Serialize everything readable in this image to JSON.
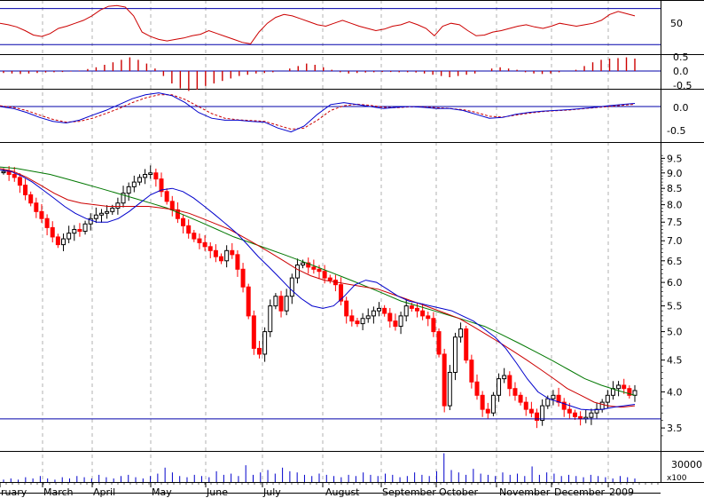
{
  "chart_data": {
    "type": "candlestick",
    "months": [
      "ruary",
      "March",
      "April",
      "May",
      "June",
      "July",
      "August",
      "September",
      "October",
      "November",
      "December",
      "2009"
    ],
    "price_axis": {
      "ticks": [
        "3.5",
        "4.0",
        "4.5",
        "5.0",
        "5.5",
        "6.0",
        "6.5",
        "7.0",
        "7.5",
        "8.0",
        "8.5",
        "9.0",
        "9.5"
      ],
      "ylim": [
        3.3,
        9.7
      ],
      "scale": "log",
      "horizontal_line": 3.62
    },
    "rsi_panel": {
      "ticks": [
        "50"
      ],
      "lines": [
        82,
        33
      ]
    },
    "histogram_panel": {
      "ticks": [
        "0.5",
        "0.0",
        "-0.5"
      ]
    },
    "macd_panel": {
      "ticks": [
        "0.0",
        "-0.5"
      ]
    },
    "volume_panel": {
      "ticks": [
        "30000",
        "x100"
      ]
    },
    "colors": {
      "up_candle": "#000000",
      "down_candle": "#ff0000",
      "ma_short": "#0000cc",
      "ma_medium": "#cc0000",
      "ma_long": "#007700",
      "panel_line": "#0000aa",
      "indicator": "#cc0000"
    },
    "price_series": [
      9.05,
      8.95,
      8.85,
      8.6,
      8.3,
      8.05,
      7.8,
      7.6,
      7.35,
      7.1,
      6.9,
      7.05,
      7.2,
      7.3,
      7.25,
      7.45,
      7.6,
      7.7,
      7.75,
      7.8,
      7.9,
      8.05,
      8.35,
      8.55,
      8.7,
      8.85,
      8.95,
      9.0,
      8.8,
      8.4,
      8.1,
      7.85,
      7.6,
      7.4,
      7.2,
      7.05,
      6.95,
      6.85,
      6.75,
      6.6,
      6.5,
      6.75,
      6.65,
      6.3,
      5.9,
      5.3,
      4.7,
      4.6,
      5.0,
      5.5,
      5.7,
      5.4,
      5.7,
      6.1,
      6.4,
      6.45,
      6.35,
      6.3,
      6.25,
      6.1,
      6.05,
      5.95,
      5.6,
      5.3,
      5.2,
      5.15,
      5.25,
      5.3,
      5.4,
      5.45,
      5.35,
      5.2,
      5.1,
      5.3,
      5.5,
      5.45,
      5.4,
      5.3,
      5.25,
      5.0,
      4.6,
      3.8,
      4.3,
      4.9,
      5.05,
      4.5,
      4.15,
      3.95,
      3.75,
      3.7,
      3.95,
      4.2,
      4.25,
      4.05,
      3.95,
      3.85,
      3.75,
      3.7,
      3.6,
      3.8,
      3.9,
      3.95,
      3.85,
      3.75,
      3.7,
      3.65,
      3.62,
      3.64,
      3.7,
      3.75,
      3.85,
      3.95,
      4.05,
      4.1,
      4.05,
      3.95,
      4.02
    ],
    "ma_short": [
      9.1,
      9.05,
      8.9,
      8.7,
      8.45,
      8.2,
      7.95,
      7.75,
      7.6,
      7.5,
      7.5,
      7.6,
      7.8,
      8.05,
      8.3,
      8.45,
      8.5,
      8.4,
      8.2,
      7.95,
      7.7,
      7.45,
      7.2,
      6.9,
      6.6,
      6.35,
      6.1,
      5.85,
      5.65,
      5.5,
      5.45,
      5.5,
      5.7,
      5.95,
      6.05,
      6.0,
      5.85,
      5.7,
      5.6,
      5.55,
      5.5,
      5.45,
      5.4,
      5.3,
      5.2,
      5.05,
      4.9,
      4.7,
      4.45,
      4.2,
      4.0,
      3.9,
      3.85,
      3.8,
      3.75,
      3.74,
      3.75,
      3.78,
      3.8,
      3.82
    ],
    "ma_medium": [
      9.15,
      9.05,
      8.85,
      8.6,
      8.35,
      8.15,
      8.05,
      8.0,
      7.95,
      7.95,
      7.95,
      7.95,
      7.9,
      7.85,
      7.75,
      7.6,
      7.45,
      7.3,
      7.1,
      6.9,
      6.7,
      6.5,
      6.3,
      6.15,
      6.05,
      6.0,
      5.95,
      5.9,
      5.85,
      5.75,
      5.65,
      5.55,
      5.45,
      5.35,
      5.25,
      5.1,
      4.95,
      4.8,
      4.65,
      4.5,
      4.35,
      4.2,
      4.05,
      3.95,
      3.85,
      3.8,
      3.78,
      3.8
    ],
    "ma_long": [
      9.2,
      9.15,
      9.05,
      8.95,
      8.8,
      8.65,
      8.5,
      8.35,
      8.2,
      8.05,
      7.9,
      7.7,
      7.5,
      7.3,
      7.1,
      6.95,
      6.8,
      6.65,
      6.5,
      6.35,
      6.2,
      6.05,
      5.9,
      5.75,
      5.6,
      5.5,
      5.4,
      5.3,
      5.2,
      5.1,
      4.95,
      4.8,
      4.65,
      4.5,
      4.35,
      4.2,
      4.1,
      4.02,
      3.95
    ],
    "rsi_series": [
      62,
      60,
      57,
      52,
      46,
      44,
      48,
      55,
      58,
      62,
      66,
      72,
      80,
      85,
      86,
      84,
      72,
      50,
      44,
      40,
      38,
      40,
      42,
      45,
      47,
      52,
      48,
      44,
      40,
      36,
      34,
      50,
      62,
      70,
      74,
      72,
      68,
      64,
      60,
      58,
      62,
      66,
      62,
      58,
      55,
      52,
      54,
      58,
      60,
      64,
      60,
      55,
      45,
      58,
      62,
      60,
      52,
      45,
      46,
      50,
      52,
      55,
      58,
      60,
      57,
      55,
      58,
      62,
      60,
      58,
      60,
      62,
      66,
      74,
      78,
      75,
      72
    ],
    "histogram_series": [
      -0.08,
      -0.1,
      -0.12,
      -0.1,
      -0.08,
      -0.06,
      -0.05,
      -0.04,
      -0.02,
      0.02,
      0.08,
      0.15,
      0.25,
      0.35,
      0.45,
      0.55,
      0.45,
      0.3,
      0.1,
      -0.2,
      -0.5,
      -0.7,
      -0.8,
      -0.75,
      -0.6,
      -0.5,
      -0.4,
      -0.3,
      -0.2,
      -0.15,
      -0.1,
      -0.08,
      -0.05,
      0.0,
      0.1,
      0.2,
      0.3,
      0.25,
      0.15,
      0.05,
      -0.05,
      -0.1,
      -0.08,
      -0.06,
      -0.05,
      -0.04,
      -0.04,
      -0.05,
      -0.05,
      -0.06,
      -0.1,
      -0.15,
      -0.2,
      -0.25,
      -0.2,
      -0.15,
      -0.1,
      0.0,
      0.1,
      0.15,
      0.1,
      0.05,
      -0.05,
      -0.1,
      -0.12,
      -0.1,
      -0.05,
      0.0,
      0.05,
      0.2,
      0.35,
      0.45,
      0.5,
      0.52,
      0.55,
      0.5
    ],
    "macd_series": [
      0.0,
      -0.05,
      -0.15,
      -0.28,
      -0.38,
      -0.42,
      -0.35,
      -0.22,
      -0.1,
      0.05,
      0.2,
      0.3,
      0.35,
      0.28,
      0.1,
      -0.15,
      -0.3,
      -0.35,
      -0.35,
      -0.38,
      -0.4,
      -0.55,
      -0.65,
      -0.5,
      -0.2,
      0.05,
      0.1,
      0.05,
      0.0,
      -0.05,
      -0.02,
      0.0,
      -0.02,
      -0.05,
      -0.05,
      -0.1,
      -0.2,
      -0.3,
      -0.28,
      -0.2,
      -0.15,
      -0.12,
      -0.1,
      -0.08,
      -0.05,
      -0.02,
      0.02,
      0.05,
      0.08
    ],
    "macd_signal": [
      0.02,
      -0.02,
      -0.1,
      -0.22,
      -0.33,
      -0.4,
      -0.38,
      -0.3,
      -0.18,
      -0.05,
      0.1,
      0.22,
      0.3,
      0.3,
      0.18,
      0.0,
      -0.18,
      -0.3,
      -0.34,
      -0.36,
      -0.38,
      -0.48,
      -0.58,
      -0.55,
      -0.35,
      -0.1,
      0.02,
      0.06,
      0.03,
      -0.02,
      -0.03,
      -0.01,
      -0.01,
      -0.03,
      -0.05,
      -0.08,
      -0.15,
      -0.25,
      -0.27,
      -0.22,
      -0.17,
      -0.13,
      -0.11,
      -0.09,
      -0.06,
      -0.03,
      0.0,
      0.03,
      0.06
    ],
    "volume_series": [
      2,
      3,
      2,
      4,
      3,
      5,
      3,
      2,
      4,
      3,
      5,
      4,
      3,
      6,
      4,
      3,
      5,
      6,
      4,
      3,
      5,
      7,
      12,
      8,
      5,
      4,
      6,
      5,
      4,
      9,
      6,
      7,
      5,
      14,
      6,
      8,
      10,
      7,
      12,
      9,
      8,
      6,
      5,
      7,
      6,
      5,
      4,
      6,
      5,
      8,
      6,
      5,
      7,
      6,
      4,
      5,
      8,
      6,
      5,
      9,
      24,
      10,
      8,
      6,
      11,
      7,
      6,
      5,
      8,
      6,
      7,
      5,
      13,
      6,
      8,
      7,
      5,
      6,
      5,
      4,
      6,
      5,
      4,
      3,
      5,
      4,
      3
    ]
  }
}
